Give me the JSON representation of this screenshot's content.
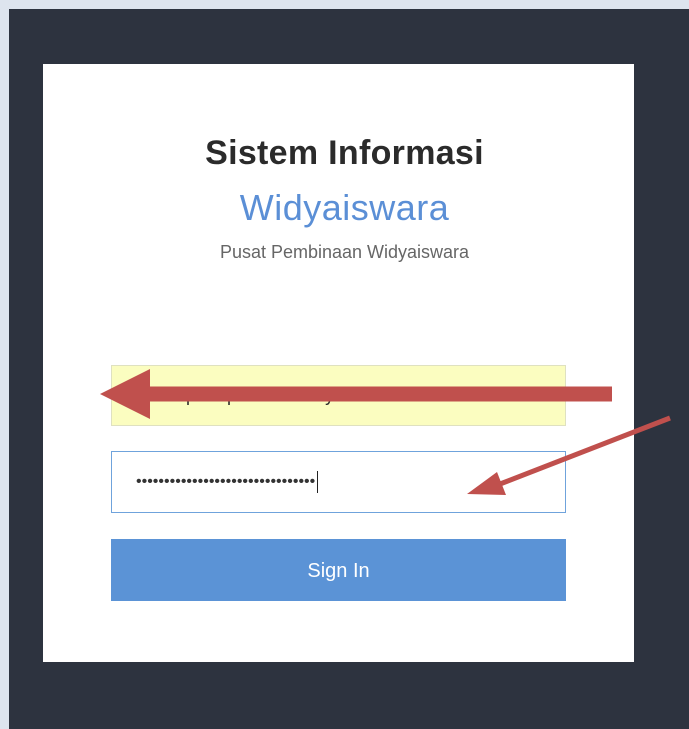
{
  "header": {
    "title": "Sistem Informasi",
    "subtitle": "Widyaiswara",
    "tagline": "Pusat Pembinaan Widyaiswara"
  },
  "form": {
    "username_value": "chretpr aapanvmio un yonana",
    "password_masked": "••••••••••••••••••••••••••••••••",
    "signin_label": "Sign In"
  },
  "colors": {
    "page_bg": "#2d333f",
    "card_bg": "#ffffff",
    "accent": "#5b93d6",
    "autofill": "#fbfdc0",
    "annotation_arrow": "#c0504d"
  },
  "annotations": {
    "arrows": [
      "arrow-pointing-username-field",
      "arrow-pointing-password-field"
    ]
  }
}
